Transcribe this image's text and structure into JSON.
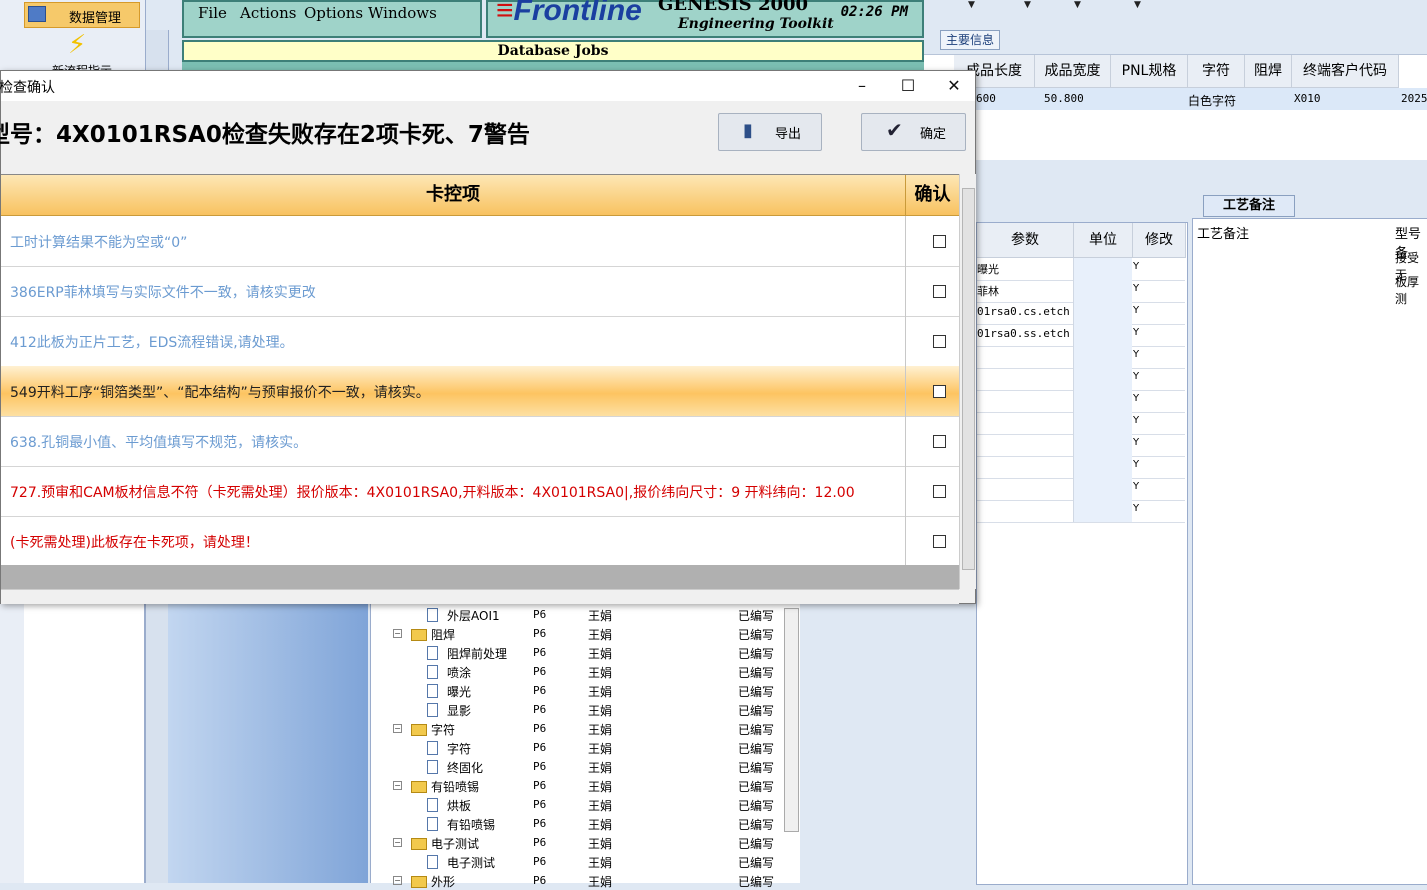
{
  "nav": {
    "data_mgmt": "数据管理",
    "workflow": "新流程指示"
  },
  "genesis": {
    "menu": [
      "File",
      "Actions",
      "Options",
      "Windows"
    ],
    "brand": "Frontline",
    "product": "GENESIS 2000",
    "toolkit": "Engineering Toolkit",
    "clock": "02:26 PM",
    "jobs_title": "Database Jobs"
  },
  "main_info": {
    "tab": "主要信息",
    "headers": [
      "成品长度",
      "成品宽度",
      "PNL规格",
      "字符",
      "阻焊",
      "终端客户代码"
    ],
    "row": [
      "600",
      "50.800",
      "",
      "白色字符",
      "X010",
      "2025-"
    ]
  },
  "params": {
    "headers": [
      "参数",
      "单位",
      "修改"
    ],
    "rows": [
      {
        "name": "曝光",
        "mod": "Y"
      },
      {
        "name": "菲林",
        "mod": "Y"
      },
      {
        "name": "01rsa0.cs.etch",
        "mod": "Y"
      },
      {
        "name": "01rsa0.ss.etch",
        "mod": "Y"
      },
      {
        "name": "",
        "mod": "Y"
      },
      {
        "name": "",
        "mod": "Y"
      },
      {
        "name": "",
        "mod": "Y"
      },
      {
        "name": "",
        "mod": "Y"
      },
      {
        "name": "",
        "mod": "Y"
      },
      {
        "name": "",
        "mod": "Y"
      },
      {
        "name": "",
        "mod": "Y"
      },
      {
        "name": "",
        "mod": "Y"
      }
    ]
  },
  "memo": {
    "tab": "工艺备注",
    "header": "工艺备注",
    "col2": "型号备",
    "values": [
      "接受无",
      "板厚测"
    ]
  },
  "tree": {
    "rows": [
      {
        "name": "外层AOI1",
        "p": "P6",
        "o": "王娟",
        "s": "已编写",
        "type": "doc",
        "indent": 1
      },
      {
        "name": "阻焊",
        "p": "P6",
        "o": "王娟",
        "s": "已编写",
        "type": "folder",
        "indent": 0
      },
      {
        "name": "阻焊前处理",
        "p": "P6",
        "o": "王娟",
        "s": "已编写",
        "type": "doc",
        "indent": 1
      },
      {
        "name": "喷涂",
        "p": "P6",
        "o": "王娟",
        "s": "已编写",
        "type": "doc",
        "indent": 1
      },
      {
        "name": "曝光",
        "p": "P6",
        "o": "王娟",
        "s": "已编写",
        "type": "doc",
        "indent": 1
      },
      {
        "name": "显影",
        "p": "P6",
        "o": "王娟",
        "s": "已编写",
        "type": "doc",
        "indent": 1
      },
      {
        "name": "字符",
        "p": "P6",
        "o": "王娟",
        "s": "已编写",
        "type": "folder",
        "indent": 0
      },
      {
        "name": "字符",
        "p": "P6",
        "o": "王娟",
        "s": "已编写",
        "type": "doc",
        "indent": 1
      },
      {
        "name": "终固化",
        "p": "P6",
        "o": "王娟",
        "s": "已编写",
        "type": "doc",
        "indent": 1
      },
      {
        "name": "有铅喷锡",
        "p": "P6",
        "o": "王娟",
        "s": "已编写",
        "type": "folder",
        "indent": 0
      },
      {
        "name": "烘板",
        "p": "P6",
        "o": "王娟",
        "s": "已编写",
        "type": "doc",
        "indent": 1
      },
      {
        "name": "有铅喷锡",
        "p": "P6",
        "o": "王娟",
        "s": "已编写",
        "type": "doc",
        "indent": 1
      },
      {
        "name": "电子测试",
        "p": "P6",
        "o": "王娟",
        "s": "已编写",
        "type": "folder",
        "indent": 0
      },
      {
        "name": "电子测试",
        "p": "P6",
        "o": "王娟",
        "s": "已编写",
        "type": "doc",
        "indent": 1
      },
      {
        "name": "外形",
        "p": "P6",
        "o": "王娟",
        "s": "已编写",
        "type": "folder",
        "indent": 0
      }
    ]
  },
  "dialog": {
    "title": "检查确认",
    "heading": "型号：4X0101RSA0检查失败存在2项卡死、7警告",
    "export_label": "导出",
    "confirm_label": "确定",
    "col_item": "卡控项",
    "col_confirm": "确认",
    "colors": {
      "warning": "#6b9bd1",
      "normal": "#222222",
      "fatal": "#d40000"
    },
    "rows": [
      {
        "text": "工时计算结果不能为空或“0”",
        "level": "warning",
        "checked": false
      },
      {
        "text": "386ERP菲林填写与实际文件不一致，请核实更改",
        "level": "warning",
        "checked": false
      },
      {
        "text": "412此板为正片工艺，EDS流程错误,请处理。",
        "level": "warning",
        "checked": false
      },
      {
        "text": "549开料工序“铜箔类型”、“配本结构”与预审报价不一致，请核实。",
        "level": "normal",
        "checked": false,
        "selected": true
      },
      {
        "text": "638.孔铜最小值、平均值填写不规范，请核实。",
        "level": "warning",
        "checked": false
      },
      {
        "text": "727.预审和CAM板材信息不符（卡死需处理）报价版本：4X0101RSA0,开料版本：4X0101RSA0|,报价纬向尺寸：9 开料纬向：12.00",
        "level": "fatal",
        "checked": false
      },
      {
        "text": "(卡死需处理)此板存在卡死项，请处理！",
        "level": "fatal",
        "checked": false
      }
    ]
  }
}
